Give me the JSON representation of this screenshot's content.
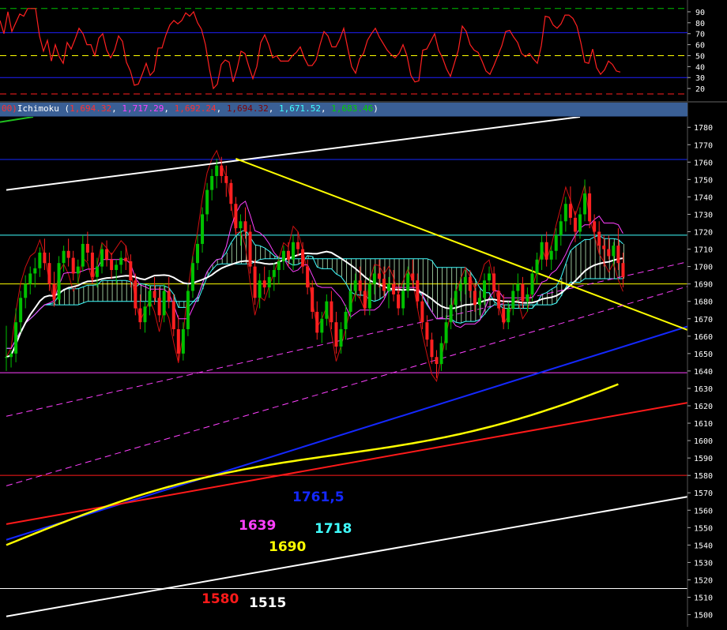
{
  "indicator_header": {
    "prefix": "00)",
    "name": "Ichimoku",
    "open_paren": " (",
    "v1": "1,694.32",
    "v2": "1,717.29",
    "v3": "1,692.24",
    "v4": "1,694.32",
    "v5": "1,671.52",
    "v6": "1,683.46",
    "close_paren": ")",
    "sep": ", ",
    "colors": {
      "prefix": "#ff3030",
      "name": "#ffffff",
      "v1": "#ff3030",
      "v2": "#ff40ff",
      "v3": "#ff3030",
      "v4": "#800000",
      "v5": "#40ffff",
      "v6": "#00d000"
    }
  },
  "colors": {
    "background": "#000000",
    "candle_up": "#00c000",
    "candle_down": "#ff2020",
    "ichimoku_cloud": "#c8ffc8",
    "white_line": "#ffffff",
    "yellow": "#ffff00",
    "blue": "#1428ff",
    "red": "#ff1a1a",
    "magenta": "#ff40ff",
    "cyan": "#40ffff"
  },
  "chart_data": [
    {
      "type": "line",
      "panel": "oscillator",
      "y_ticks": [
        90,
        80,
        70,
        60,
        50,
        40,
        30,
        20
      ],
      "levels": [
        {
          "value": 93,
          "color": "#00c000",
          "style": "dashed"
        },
        {
          "value": 71,
          "color": "#2020ff",
          "style": "solid"
        },
        {
          "value": 50,
          "color": "#ffff00",
          "style": "dashed"
        },
        {
          "value": 30,
          "color": "#2020ff",
          "style": "solid"
        },
        {
          "value": 15,
          "color": "#ff2020",
          "style": "dashed"
        }
      ],
      "series": [
        {
          "color": "#ff2020",
          "x": [
            0,
            5,
            10,
            15,
            20,
            25,
            30,
            35,
            40,
            45,
            50,
            55,
            60,
            65,
            70,
            75,
            80,
            85,
            90,
            95,
            100,
            105,
            110,
            115,
            120,
            125,
            130,
            135,
            140,
            145,
            150,
            155,
            160,
            165,
            170,
            175,
            180,
            185,
            190,
            195,
            200,
            205,
            210,
            215,
            220,
            225,
            230,
            235,
            240,
            245,
            250,
            255,
            260,
            265,
            270,
            275,
            280,
            285,
            290,
            295,
            300,
            305,
            310,
            315,
            320,
            325,
            330,
            335,
            340,
            345,
            350,
            355,
            360,
            365,
            370,
            375,
            380,
            385,
            390,
            395,
            400,
            405,
            410,
            415,
            420,
            425,
            430,
            435,
            440,
            445,
            450,
            455,
            460,
            465,
            470,
            475,
            480,
            485,
            490,
            495,
            500,
            505,
            510,
            515,
            520,
            525,
            530,
            535,
            540,
            545,
            550,
            555,
            560,
            565,
            570,
            575,
            580,
            585,
            590,
            595,
            600,
            605,
            610,
            615,
            620,
            625,
            630,
            635,
            640,
            645,
            650,
            655,
            660,
            665,
            670,
            675,
            680,
            685,
            690,
            695,
            700,
            705,
            710,
            715,
            720,
            725,
            730,
            735,
            740,
            745,
            750,
            755,
            760,
            765,
            770,
            775,
            780,
            785
          ],
          "values": [
            82,
            70,
            90,
            72,
            80,
            88,
            86,
            93,
            93,
            93,
            68,
            54,
            64,
            45,
            60,
            49,
            43,
            62,
            56,
            65,
            75,
            70,
            60,
            60,
            50,
            66,
            70,
            55,
            48,
            55,
            68,
            63,
            44,
            36,
            23,
            24,
            33,
            43,
            32,
            36,
            57,
            57,
            69,
            78,
            82,
            79,
            82,
            89,
            86,
            90,
            80,
            74,
            60,
            38,
            20,
            24,
            42,
            46,
            44,
            26,
            38,
            54,
            52,
            40,
            29,
            40,
            62,
            69,
            60,
            48,
            50,
            45,
            45,
            45,
            50,
            53,
            58,
            48,
            41,
            41,
            46,
            60,
            72,
            68,
            58,
            58,
            65,
            75,
            57,
            40,
            34,
            47,
            52,
            64,
            70,
            75,
            67,
            61,
            55,
            51,
            48,
            52,
            60,
            50,
            32,
            26,
            27,
            55,
            56,
            63,
            70,
            55,
            48,
            38,
            31,
            43,
            55,
            77,
            72,
            60,
            55,
            53,
            45,
            36,
            33,
            41,
            50,
            59,
            72,
            73,
            67,
            62,
            52,
            49,
            52,
            47,
            43,
            59,
            86,
            85,
            78,
            75,
            79,
            87,
            87,
            84,
            77,
            62,
            44,
            43,
            56,
            39,
            33,
            37,
            45,
            42,
            36,
            35
          ]
        }
      ]
    },
    {
      "type": "candlestick",
      "panel": "price",
      "ylim": [
        1493,
        1786
      ],
      "y_ticks": [
        1780,
        1770,
        1760,
        1750,
        1740,
        1730,
        1720,
        1710,
        1700,
        1690,
        1680,
        1670,
        1660,
        1650,
        1640,
        1630,
        1620,
        1610,
        1600,
        1590,
        1580,
        1570,
        1560,
        1550,
        1540,
        1530,
        1520,
        1510,
        1500
      ],
      "candles_bar_index_range": [
        0,
        130
      ],
      "candles": [
        [
          1648,
          1666,
          1640,
          1648
        ],
        [
          1648,
          1652,
          1642,
          1650
        ],
        [
          1650,
          1676,
          1645,
          1668
        ],
        [
          1668,
          1686,
          1662,
          1682
        ],
        [
          1682,
          1695,
          1676,
          1690
        ],
        [
          1690,
          1700,
          1684,
          1696
        ],
        [
          1696,
          1705,
          1688,
          1699
        ],
        [
          1699,
          1711,
          1694,
          1708
        ],
        [
          1708,
          1716,
          1698,
          1702
        ],
        [
          1702,
          1708,
          1686,
          1690
        ],
        [
          1690,
          1697,
          1677,
          1681
        ],
        [
          1681,
          1706,
          1678,
          1702
        ],
        [
          1702,
          1712,
          1697,
          1709
        ],
        [
          1709,
          1716,
          1700,
          1705
        ],
        [
          1705,
          1709,
          1692,
          1696
        ],
        [
          1696,
          1704,
          1690,
          1700
        ],
        [
          1700,
          1718,
          1697,
          1713
        ],
        [
          1713,
          1720,
          1703,
          1708
        ],
        [
          1708,
          1712,
          1690,
          1694
        ],
        [
          1694,
          1705,
          1688,
          1700
        ],
        [
          1700,
          1713,
          1696,
          1710
        ],
        [
          1710,
          1715,
          1700,
          1704
        ],
        [
          1704,
          1708,
          1693,
          1698
        ],
        [
          1698,
          1704,
          1690,
          1701
        ],
        [
          1701,
          1709,
          1696,
          1705
        ],
        [
          1705,
          1712,
          1698,
          1703
        ],
        [
          1703,
          1707,
          1688,
          1692
        ],
        [
          1692,
          1696,
          1672,
          1676
        ],
        [
          1676,
          1684,
          1664,
          1668
        ],
        [
          1668,
          1680,
          1662,
          1677
        ],
        [
          1677,
          1690,
          1672,
          1686
        ],
        [
          1686,
          1694,
          1678,
          1682
        ],
        [
          1682,
          1688,
          1668,
          1672
        ],
        [
          1672,
          1690,
          1668,
          1686
        ],
        [
          1686,
          1694,
          1676,
          1680
        ],
        [
          1680,
          1684,
          1660,
          1664
        ],
        [
          1664,
          1672,
          1646,
          1650
        ],
        [
          1650,
          1668,
          1646,
          1664
        ],
        [
          1664,
          1690,
          1660,
          1686
        ],
        [
          1686,
          1706,
          1682,
          1702
        ],
        [
          1702,
          1718,
          1698,
          1713
        ],
        [
          1713,
          1734,
          1708,
          1730
        ],
        [
          1730,
          1748,
          1726,
          1744
        ],
        [
          1744,
          1756,
          1738,
          1752
        ],
        [
          1752,
          1762,
          1745,
          1758
        ],
        [
          1758,
          1763,
          1748,
          1752
        ],
        [
          1752,
          1758,
          1740,
          1748
        ],
        [
          1748,
          1750,
          1732,
          1736
        ],
        [
          1736,
          1740,
          1718,
          1722
        ],
        [
          1722,
          1730,
          1712,
          1726
        ],
        [
          1726,
          1734,
          1716,
          1720
        ],
        [
          1720,
          1724,
          1696,
          1700
        ],
        [
          1700,
          1704,
          1678,
          1682
        ],
        [
          1682,
          1696,
          1676,
          1692
        ],
        [
          1692,
          1700,
          1684,
          1688
        ],
        [
          1688,
          1698,
          1682,
          1694
        ],
        [
          1694,
          1702,
          1686,
          1698
        ],
        [
          1698,
          1706,
          1690,
          1703
        ],
        [
          1703,
          1712,
          1698,
          1709
        ],
        [
          1709,
          1714,
          1700,
          1704
        ],
        [
          1704,
          1718,
          1698,
          1714
        ],
        [
          1714,
          1720,
          1706,
          1710
        ],
        [
          1710,
          1714,
          1696,
          1700
        ],
        [
          1700,
          1704,
          1684,
          1688
        ],
        [
          1688,
          1692,
          1670,
          1674
        ],
        [
          1674,
          1680,
          1658,
          1662
        ],
        [
          1662,
          1674,
          1656,
          1670
        ],
        [
          1670,
          1684,
          1666,
          1680
        ],
        [
          1680,
          1686,
          1664,
          1668
        ],
        [
          1668,
          1674,
          1650,
          1654
        ],
        [
          1654,
          1668,
          1650,
          1664
        ],
        [
          1664,
          1678,
          1658,
          1674
        ],
        [
          1674,
          1690,
          1670,
          1686
        ],
        [
          1686,
          1696,
          1680,
          1692
        ],
        [
          1692,
          1700,
          1682,
          1686
        ],
        [
          1686,
          1692,
          1672,
          1676
        ],
        [
          1676,
          1694,
          1672,
          1690
        ],
        [
          1690,
          1700,
          1684,
          1696
        ],
        [
          1696,
          1704,
          1688,
          1693
        ],
        [
          1693,
          1700,
          1682,
          1686
        ],
        [
          1686,
          1694,
          1676,
          1690
        ],
        [
          1690,
          1698,
          1680,
          1684
        ],
        [
          1684,
          1690,
          1672,
          1676
        ],
        [
          1676,
          1690,
          1672,
          1686
        ],
        [
          1686,
          1700,
          1682,
          1696
        ],
        [
          1696,
          1704,
          1688,
          1692
        ],
        [
          1692,
          1696,
          1676,
          1680
        ],
        [
          1680,
          1684,
          1664,
          1668
        ],
        [
          1668,
          1672,
          1654,
          1658
        ],
        [
          1658,
          1662,
          1644,
          1648
        ],
        [
          1648,
          1652,
          1636,
          1644
        ],
        [
          1644,
          1660,
          1640,
          1656
        ],
        [
          1656,
          1672,
          1652,
          1668
        ],
        [
          1668,
          1682,
          1664,
          1678
        ],
        [
          1678,
          1690,
          1674,
          1686
        ],
        [
          1686,
          1694,
          1680,
          1690
        ],
        [
          1690,
          1698,
          1684,
          1694
        ],
        [
          1694,
          1698,
          1682,
          1686
        ],
        [
          1686,
          1690,
          1674,
          1678
        ],
        [
          1678,
          1686,
          1672,
          1682
        ],
        [
          1682,
          1696,
          1678,
          1692
        ],
        [
          1692,
          1700,
          1686,
          1696
        ],
        [
          1696,
          1700,
          1682,
          1686
        ],
        [
          1686,
          1690,
          1672,
          1676
        ],
        [
          1676,
          1684,
          1664,
          1668
        ],
        [
          1668,
          1680,
          1664,
          1676
        ],
        [
          1676,
          1690,
          1672,
          1686
        ],
        [
          1686,
          1696,
          1680,
          1690
        ],
        [
          1690,
          1694,
          1676,
          1680
        ],
        [
          1680,
          1688,
          1674,
          1684
        ],
        [
          1684,
          1700,
          1680,
          1696
        ],
        [
          1696,
          1708,
          1690,
          1704
        ],
        [
          1704,
          1718,
          1698,
          1714
        ],
        [
          1714,
          1720,
          1700,
          1704
        ],
        [
          1704,
          1712,
          1698,
          1709
        ],
        [
          1709,
          1722,
          1704,
          1718
        ],
        [
          1718,
          1730,
          1712,
          1726
        ],
        [
          1726,
          1740,
          1720,
          1736
        ],
        [
          1736,
          1746,
          1724,
          1728
        ],
        [
          1728,
          1732,
          1714,
          1720
        ],
        [
          1720,
          1734,
          1716,
          1730
        ],
        [
          1730,
          1750,
          1726,
          1742
        ],
        [
          1742,
          1746,
          1722,
          1726
        ],
        [
          1726,
          1730,
          1716,
          1720
        ],
        [
          1720,
          1726,
          1708,
          1712
        ],
        [
          1712,
          1718,
          1700,
          1710
        ],
        [
          1710,
          1718,
          1704,
          1706
        ],
        [
          1706,
          1714,
          1700,
          1712
        ],
        [
          1712,
          1722,
          1698,
          1702
        ],
        [
          1702,
          1708,
          1688,
          1694
        ]
      ],
      "hlines": [
        {
          "value": 1761.5,
          "color": "#1428ff",
          "label": "1761,5"
        },
        {
          "value": 1718,
          "color": "#40ffff",
          "label": "1718"
        },
        {
          "value": 1690,
          "color": "#ffff00",
          "label": "1690"
        },
        {
          "value": 1639,
          "color": "#ff40ff",
          "label": "1639"
        },
        {
          "value": 1580,
          "color": "#ff1a1a",
          "label": "1580"
        },
        {
          "value": 1515,
          "color": "#ffffff",
          "label": "1515"
        }
      ]
    }
  ]
}
